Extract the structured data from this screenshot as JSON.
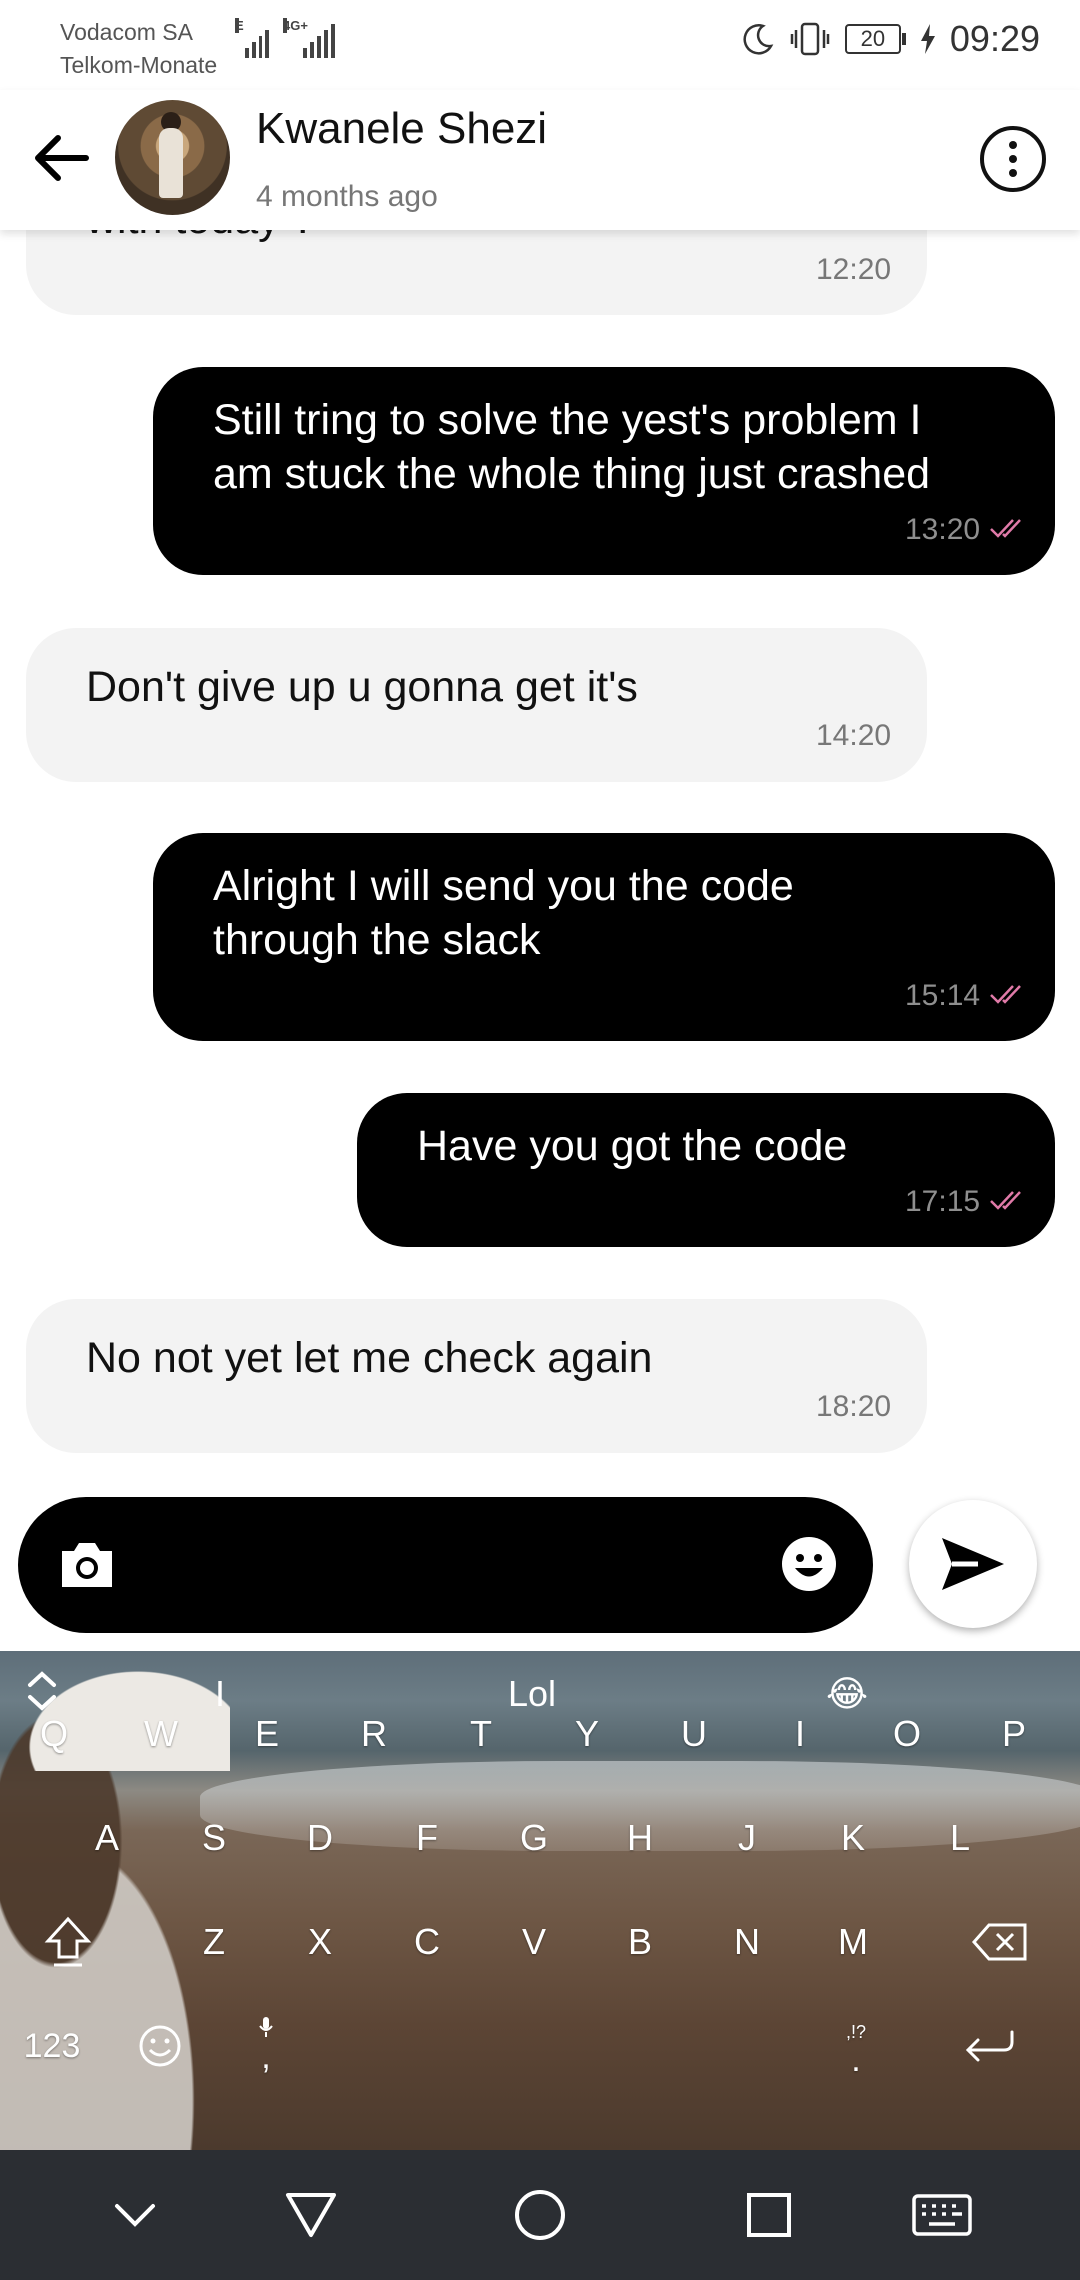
{
  "status_bar": {
    "carrier_1": "Vodacom SA",
    "carrier_2": "Telkom-Monate",
    "signal_1_tag": "E",
    "signal_2_tag": "4G+",
    "battery": "20",
    "time": "09:29",
    "icons": [
      "moon-icon",
      "vibrate-icon",
      "battery-icon",
      "charging-icon"
    ]
  },
  "header": {
    "contact_name": "Kwanele Shezi",
    "last_seen": "4 months ago",
    "icons": [
      "back-arrow-icon",
      "more-options-icon"
    ]
  },
  "messages": [
    {
      "direction": "incoming",
      "text": "with today ?",
      "time": "12:20"
    },
    {
      "direction": "outgoing",
      "text": "Still tring to solve the yest's problem I\nam stuck the whole thing just crashed",
      "time": "13:20",
      "read": true
    },
    {
      "direction": "incoming",
      "text": "Don't give up u gonna get it's",
      "time": "14:20"
    },
    {
      "direction": "outgoing",
      "text": "Alright I will send you the code\nthrough the slack",
      "time": "15:14",
      "read": true
    },
    {
      "direction": "outgoing",
      "text": "Have you got the code",
      "time": "17:15",
      "read": true
    },
    {
      "direction": "incoming",
      "text": "No not yet let me check again",
      "time": "18:20"
    }
  ],
  "composer": {
    "value": "",
    "placeholder": "",
    "icons": [
      "camera-icon",
      "emoji-icon",
      "send-icon"
    ]
  },
  "keyboard": {
    "suggestions": [
      "I",
      "Lol",
      "😂"
    ],
    "row1": [
      "Q",
      "W",
      "E",
      "R",
      "T",
      "Y",
      "U",
      "I",
      "O",
      "P"
    ],
    "row2": [
      "A",
      "S",
      "D",
      "F",
      "G",
      "H",
      "J",
      "K",
      "L"
    ],
    "row3": [
      "Z",
      "X",
      "C",
      "V",
      "B",
      "N",
      "M"
    ],
    "numbers_key": "123",
    "comma_key": ",",
    "punct_key": ",!?",
    "period_key": "."
  },
  "nav_bar": {
    "icons": [
      "hide-keyboard-chevron-icon",
      "back-triangle-icon",
      "home-circle-icon",
      "recents-square-icon",
      "keyboard-switch-icon"
    ]
  },
  "colors": {
    "incoming_bubble": "#f3f3f3",
    "outgoing_bubble": "#000000",
    "read_ticks": "#e07aa8",
    "nav_bar": "#2b2e33"
  }
}
